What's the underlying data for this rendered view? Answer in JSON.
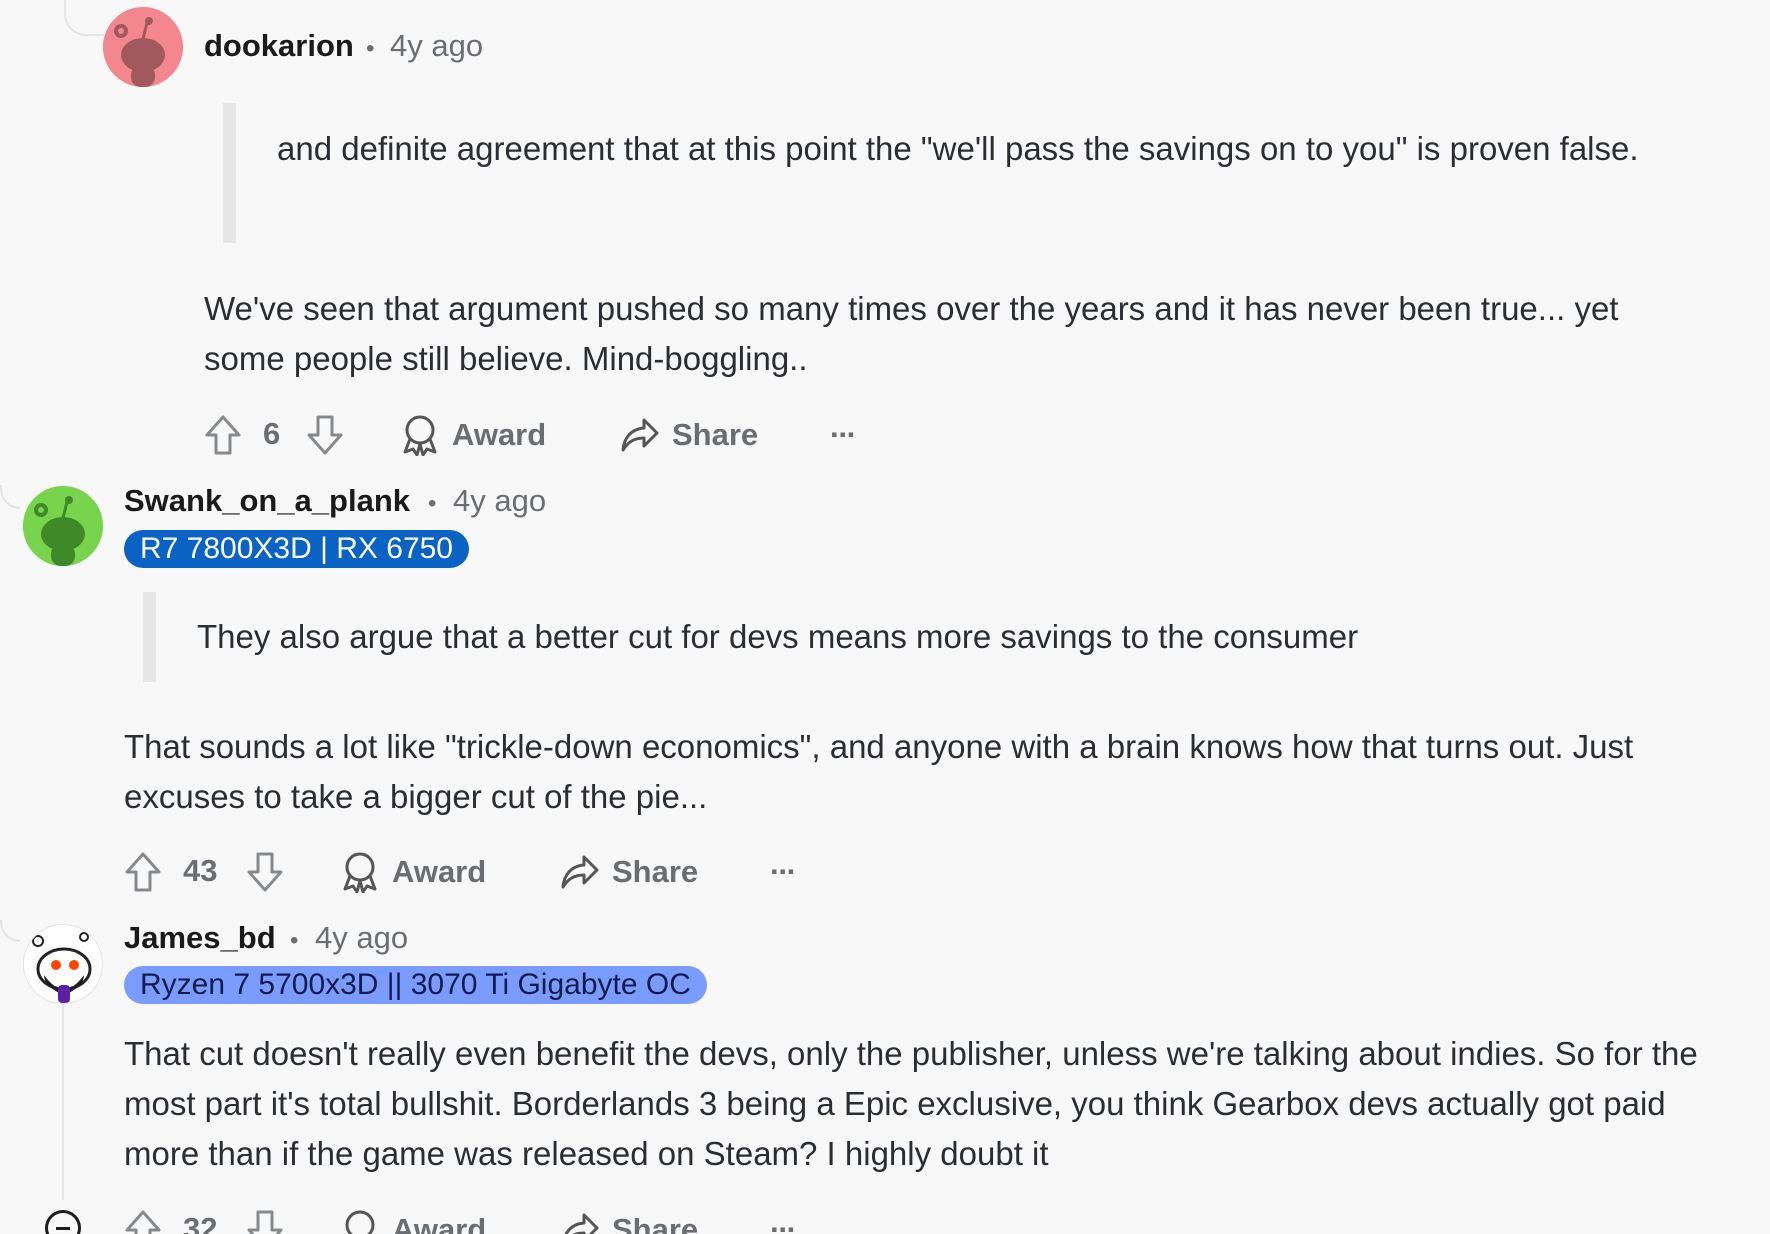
{
  "comments": [
    {
      "author": "dookarion",
      "age": "4y ago",
      "flair": "",
      "quote": "and definite agreement that at this point the \"we'll pass the savings on to you\" is proven false.",
      "body": "We've seen that argument pushed so many times over the years and it has never been true... yet some people still believe. Mind-boggling..",
      "score": "6",
      "award_label": "Award",
      "share_label": "Share",
      "more_label": "···",
      "avatar_color": "#f4868f"
    },
    {
      "author": "Swank_on_a_plank",
      "age": "4y ago",
      "flair": "R7 7800X3D | RX 6750",
      "flair_color": "#0a62c4",
      "quote": "They also argue that a better cut for devs means more savings to the consumer",
      "body": "That sounds a lot like \"trickle-down economics\", and anyone with a brain knows how that turns out. Just excuses to take a bigger cut of the pie...",
      "score": "43",
      "award_label": "Award",
      "share_label": "Share",
      "more_label": "···",
      "avatar_color": "#77d44c"
    },
    {
      "author": "James_bd",
      "age": "4y ago",
      "flair": "Ryzen 7 5700x3D || 3070 Ti Gigabyte OC",
      "flair_color": "#7a9bff",
      "body": "That cut doesn't really even benefit the devs, only the publisher, unless we're talking about indies. So for the most part it's total bullshit. Borderlands 3 being a Epic exclusive, you think Gearbox devs actually got paid more than if the game was released on Steam? I highly doubt it",
      "score": "32",
      "award_label": "Award",
      "share_label": "Share",
      "more_label": "···"
    }
  ],
  "separator": "•"
}
